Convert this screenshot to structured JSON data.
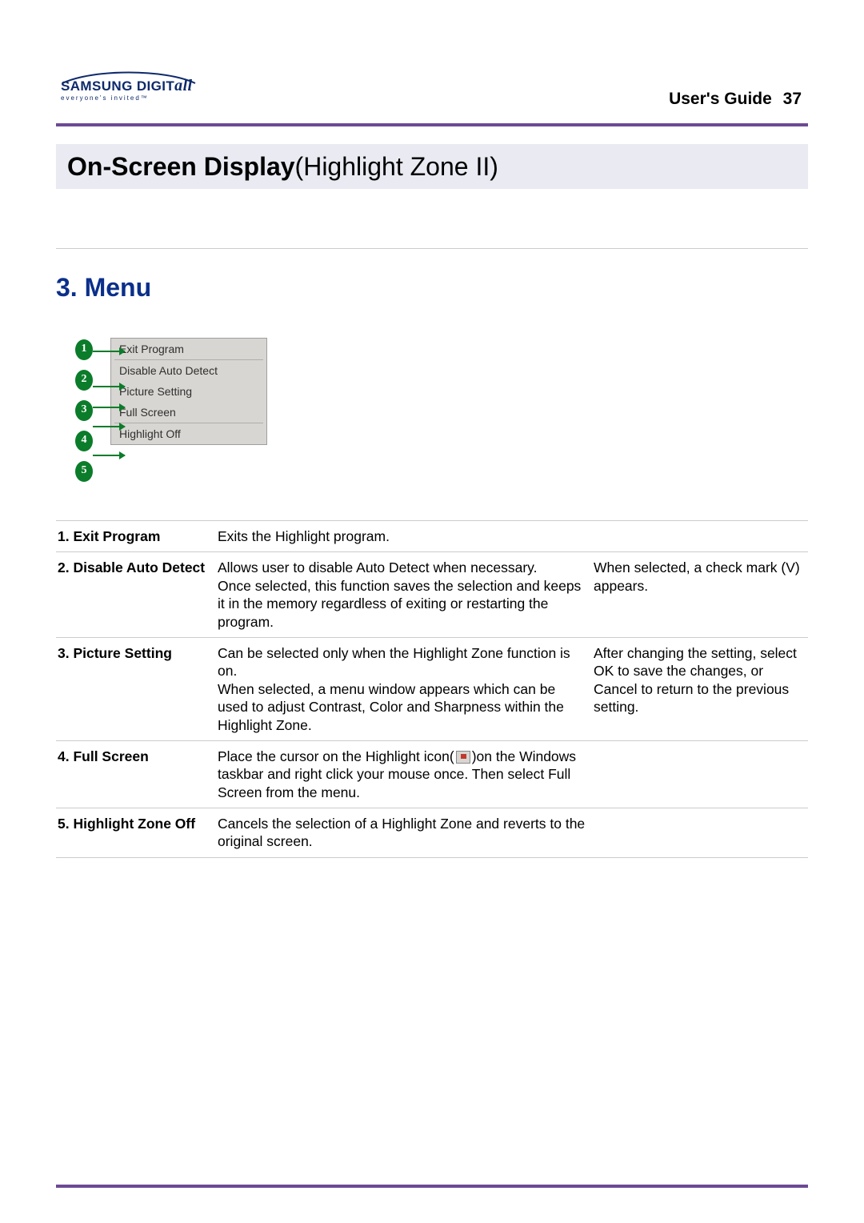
{
  "header": {
    "brand_samsung": "SAMSUNG",
    "brand_digit": "DIGIT",
    "brand_all": "all",
    "tagline": "everyone's invited™",
    "guide": "User's Guide",
    "page": "37"
  },
  "title": {
    "bold": "On-Screen Display",
    "light": "(Highlight Zone II)"
  },
  "section": "3. Menu",
  "menu": {
    "items": [
      "Exit Program",
      "Disable Auto Detect",
      "Picture Setting",
      "Full Screen",
      "Highlight Off"
    ],
    "badges": [
      "1",
      "2",
      "3",
      "4",
      "5"
    ]
  },
  "rows": [
    {
      "label": "1. Exit Program",
      "desc": "Exits the Highlight program.",
      "note": ""
    },
    {
      "label": "2. Disable Auto Detect",
      "desc": "Allows user to disable Auto Detect when necessary.\nOnce selected, this function saves the selection and keeps it in the memory regardless of exiting or restarting the program.",
      "note": "When selected, a check mark (V) appears."
    },
    {
      "label": "3. Picture Setting",
      "desc": "Can be selected only when the Highlight Zone function is on.\nWhen selected, a menu window appears which can be used to adjust Contrast, Color and Sharpness within the Highlight Zone.",
      "note": "After changing the setting, select OK to save the changes, or Cancel to return to the previous setting."
    },
    {
      "label": "4. Full Screen",
      "desc_pre": "Place the cursor on the Highlight icon(",
      "desc_post": ")on the Windows taskbar and right click your mouse once. Then select Full Screen from the menu.",
      "note": ""
    },
    {
      "label": "5. Highlight Zone Off",
      "desc": "Cancels the selection of a Highlight Zone and reverts to the original screen.",
      "note": ""
    }
  ]
}
